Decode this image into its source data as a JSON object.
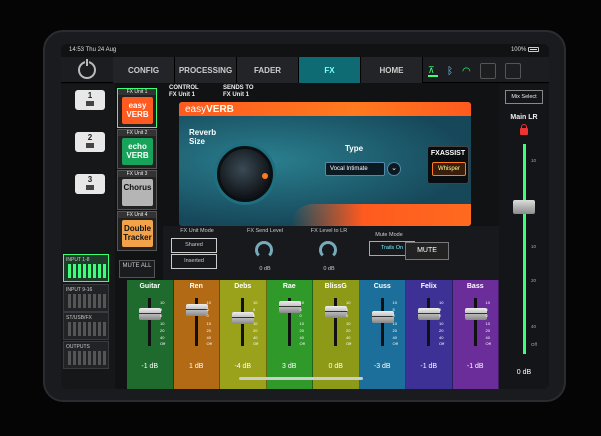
{
  "status": {
    "time_date": "14:53  Thu 24 Aug",
    "battery": "100%"
  },
  "tabs": [
    "CONFIG",
    "PROCESSING",
    "FADER",
    "FX",
    "HOME"
  ],
  "active_tab": "FX",
  "layer_buttons": [
    "1",
    "2",
    "3"
  ],
  "banks": [
    {
      "label": "INPUT 1-8",
      "active": true
    },
    {
      "label": "INPUT 9-16",
      "active": false
    },
    {
      "label": "ST/USB/FX",
      "active": false
    },
    {
      "label": "OUTPUTS",
      "active": false
    }
  ],
  "fx_units": [
    {
      "header": "FX Unit 1",
      "line1": "easy",
      "line2": "VERB",
      "color": "#ff5a1f",
      "text_color": "#ffffff"
    },
    {
      "header": "FX Unit 2",
      "line1": "echo",
      "line2": "VERB",
      "color": "#17a35a",
      "text_color": "#ffffff"
    },
    {
      "header": "FX Unit 3",
      "line1": "Chorus",
      "line2": "",
      "color": "#b5b5b5",
      "text_color": "#111111"
    },
    {
      "header": "FX Unit 4",
      "line1": "Double",
      "line2": "Tracker",
      "color": "#f2a34a",
      "text_color": "#111111"
    }
  ],
  "mute_all": "MUTE ALL",
  "control_header": {
    "control": "CONTROL",
    "control_sub": "FX Unit 1",
    "sends": "SENDS TO",
    "sends_sub": "FX Unit 1"
  },
  "plugin": {
    "brand_pre": "easy",
    "brand_main": "VERB",
    "reverb_size_label": "Reverb Size",
    "type_label": "Type",
    "type_value": "Vocal Intimate",
    "fxassist_label": "FXASSIST",
    "fxassist_preset": "Whisper"
  },
  "fx_controls": {
    "unit_mode_label": "FX Unit Mode",
    "unit_mode_options": [
      "Shared",
      "Inserted"
    ],
    "send_level_label": "FX Send Level",
    "send_level_value": "0 dB",
    "level_to_lr_label": "FX Level to LR",
    "level_to_lr_value": "0 dB",
    "mute_mode_label": "Mute Mode",
    "mute_mode_value": "Trails On",
    "mute_label": "MUTE"
  },
  "channels": [
    {
      "name": "Guitar",
      "value": "-1 dB",
      "color": "#1f6a2d"
    },
    {
      "name": "Ren",
      "value": "1 dB",
      "color": "#b36a14"
    },
    {
      "name": "Debs",
      "value": "-4 dB",
      "color": "#9aa11a"
    },
    {
      "name": "Rae",
      "value": "3 dB",
      "color": "#2f9a2a"
    },
    {
      "name": "BlissG",
      "value": "0 dB",
      "color": "#8d9a18"
    },
    {
      "name": "Cuss",
      "value": "-3 dB",
      "color": "#1c6f9a"
    },
    {
      "name": "Felix",
      "value": "-1 dB",
      "color": "#3e3196"
    },
    {
      "name": "Bass",
      "value": "-1 dB",
      "color": "#6a2d9a"
    }
  ],
  "fader_scale": [
    "10",
    "5",
    "0",
    "10",
    "20",
    "40",
    "Off"
  ],
  "master": {
    "mix_select": "Mix Select",
    "title": "Main LR",
    "value": "0 dB",
    "scale": [
      "10",
      "0",
      "10",
      "20",
      "40",
      "Off"
    ]
  }
}
